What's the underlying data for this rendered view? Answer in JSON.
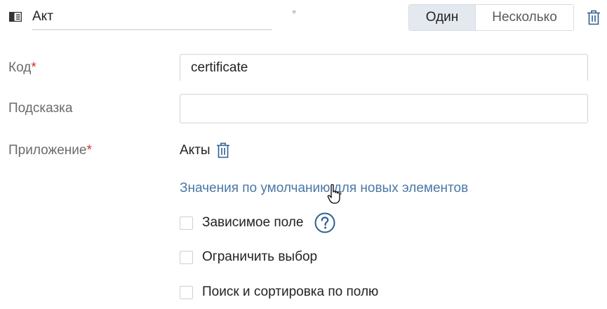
{
  "field": {
    "name_value": "Акт",
    "required_mark": "*"
  },
  "mode_toggle": {
    "options": [
      "Один",
      "Несколько"
    ],
    "selected": "Один"
  },
  "form": {
    "code": {
      "label": "Код",
      "required": "*",
      "value": "certificate"
    },
    "hint": {
      "label": "Подсказка",
      "value": ""
    },
    "app": {
      "label": "Приложение",
      "required": "*",
      "value": "Акты"
    }
  },
  "defaults_link": "Значения по умолчанию для новых элементов",
  "checkboxes": [
    {
      "label": "Зависимое поле",
      "checked": false
    },
    {
      "label": "Ограничить выбор",
      "checked": false
    },
    {
      "label": "Поиск и сортировка по полю",
      "checked": false
    }
  ],
  "colors": {
    "accent_link": "#4a78a6",
    "required": "#d0312d",
    "toggle_active_bg": "#e3e9ee",
    "icon_blue": "#2f5f8f"
  },
  "icons": {
    "field_type": "list-type-icon",
    "delete": "trash-icon",
    "help": "question-circle-icon",
    "cursor": "hand-pointer-cursor"
  }
}
